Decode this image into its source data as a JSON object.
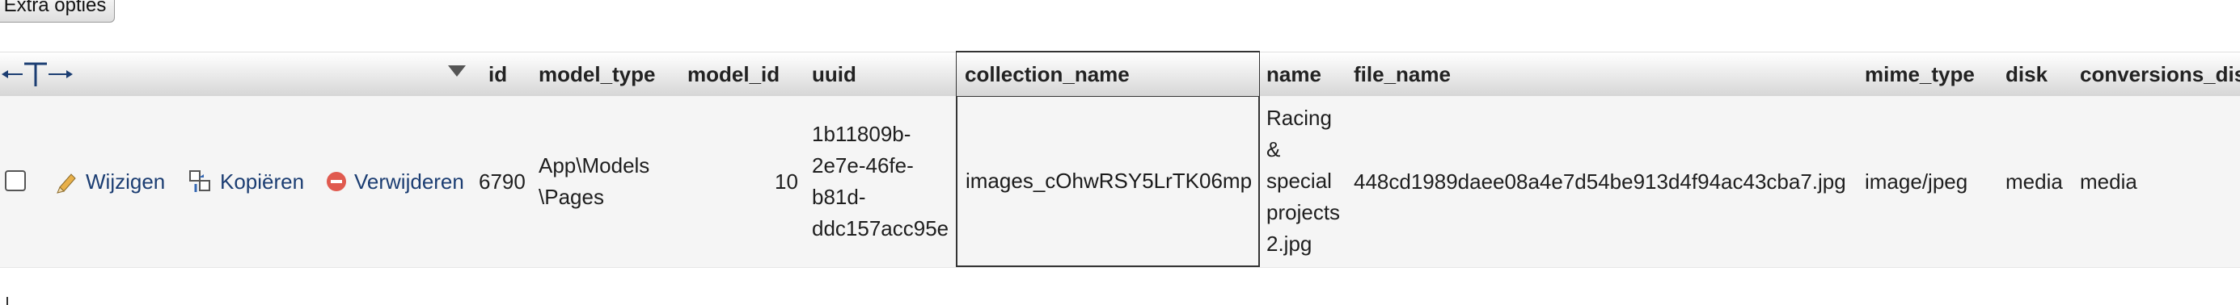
{
  "toolbar": {
    "extra_options_label": "Extra opties"
  },
  "table": {
    "columns": [
      "id",
      "model_type",
      "model_id",
      "uuid",
      "collection_name",
      "name",
      "file_name",
      "mime_type",
      "disk",
      "conversions_dis"
    ],
    "actions": {
      "edit": "Wijzigen",
      "copy": "Kopiëren",
      "delete": "Verwijderen"
    },
    "row": {
      "id": "6790",
      "model_type_lines": [
        "App\\Models",
        "\\Pages"
      ],
      "model_id": "10",
      "uuid_lines": [
        "1b11809b-",
        "2e7e-46fe-",
        "b81d-",
        "ddc157acc95e"
      ],
      "collection_name": "images_cOhwRSY5LrTK06mp",
      "name_lines": [
        "Racing",
        "&",
        "special",
        "projects",
        "2.jpg"
      ],
      "file_name": "448cd1989daee08a4e7d54be913d4f94ac43cba7.jpg",
      "mime_type": "image/jpeg",
      "disk": "media",
      "conversions_disk": "media"
    }
  },
  "colors": {
    "link": "#1b3d72",
    "delete_icon": "#e05a4f",
    "header_bg": "#e9e9e9",
    "row_bg": "#f5f5f5"
  }
}
